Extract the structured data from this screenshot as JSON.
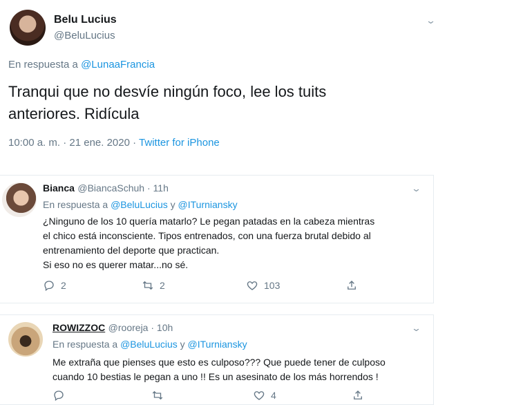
{
  "main_tweet": {
    "name": "Belu Lucius",
    "handle": "@BeluLucius",
    "reply_prefix": "En respuesta a ",
    "reply_to": "@LunaaFrancia",
    "text": "Tranqui que no desvíe ningún foco, lee los tuits anteriores. Ridícula",
    "time": "10:00 a. m. · 21 ene. 2020 · ",
    "source": "Twitter for iPhone"
  },
  "replies": [
    {
      "name": "Bianca",
      "handle": "@BiancaSchuh · 11h",
      "reply_prefix": "En respuesta a ",
      "reply_to_1": "@BeluLucius",
      "reply_and": " y ",
      "reply_to_2": "@ITurniansky",
      "lines": [
        "¿Ninguno de los 10 quería matarlo? Le pegan patadas en la cabeza mientras",
        "el chico está inconsciente. Tipos entrenados, con una fuerza brutal debido al",
        "entrenamiento del deporte que practican.",
        "Si eso no es querer matar...no sé."
      ],
      "replies_count": "2",
      "retweets_count": "2",
      "likes_count": "103"
    },
    {
      "name": "ROWIZZOC",
      "handle": "@rooreja · 10h",
      "reply_prefix": "En respuesta a ",
      "reply_to_1": "@BeluLucius",
      "reply_and": " y ",
      "reply_to_2": "@ITurniansky",
      "lines": [
        "Me extraña que pienses que esto es culposo??? Que puede tener de culposo",
        "cuando 10 bestias le pegan a uno !! Es un asesinato de los más horrendos !"
      ],
      "replies_count": "",
      "retweets_count": "",
      "likes_count": "4"
    }
  ],
  "colors": {
    "link": "#1b95e0",
    "muted": "#657786",
    "text": "#14171a",
    "border": "#e6ecf0"
  },
  "icons": [
    "chevron-down-icon",
    "reply-icon",
    "retweet-icon",
    "like-icon",
    "share-icon"
  ]
}
